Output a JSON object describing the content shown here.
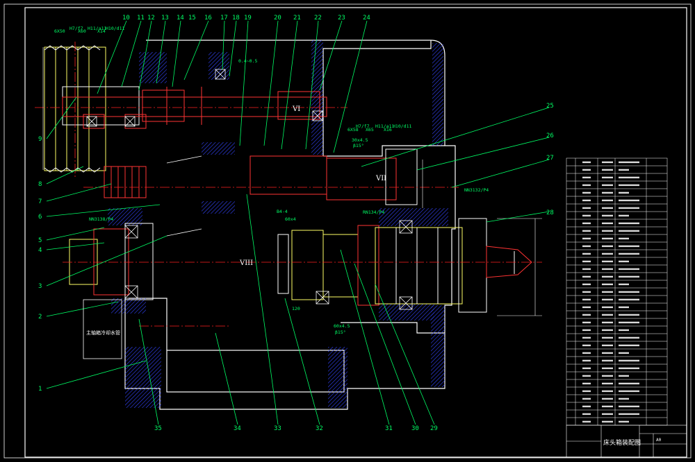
{
  "drawing": {
    "title": "床头箱装配图",
    "sheet_size": "A0",
    "side_note": "主轴箱冷却水管"
  },
  "callouts": {
    "left": [
      "9",
      "8",
      "7",
      "6",
      "5",
      "4",
      "3",
      "2",
      "1"
    ],
    "top": [
      "10",
      "11",
      "12",
      "13",
      "14",
      "15",
      "16",
      "17",
      "18",
      "19",
      "20",
      "21",
      "22",
      "23",
      "24"
    ],
    "right": [
      "25",
      "26",
      "27",
      "28"
    ],
    "bottom": [
      "35",
      "34",
      "33",
      "32",
      "31",
      "30",
      "29"
    ]
  },
  "dimensions": {
    "spline1": "6X50",
    "spline1_fit": "H7/f7",
    "spline1_b": "X60",
    "spline1_fit2": "H11/a11",
    "spline1_c": "X14",
    "spline1_fit3": "H10/d11",
    "spline2": "6X58",
    "spline2_fit": "H7/f7",
    "spline2_b": "X65",
    "spline2_fit2": "H11/a11",
    "spline2_c": "X16",
    "spline2_fit3": "H10/d11",
    "chamfer1": "30x4.5",
    "chamfer1_deg": "β15°",
    "chamfer2": "60x4.5",
    "chamfer2_deg": "β15°",
    "bearing1": "NN3132/P4",
    "bearing2": "NN3138/P4",
    "bearing3": "RN134/P4",
    "gap": "0.4~0.5",
    "small1": "B4-4",
    "small2": "60x4",
    "h120": "120"
  },
  "shafts": [
    "VI",
    "VII",
    "VIII"
  ],
  "bom_rows": 35,
  "colors": {
    "frame": "#ffffff",
    "part": "#ff3333",
    "callout": "#00ff66",
    "hatch": "#3344ff",
    "centerline": "#ff2020",
    "outline": "#ffff66"
  }
}
